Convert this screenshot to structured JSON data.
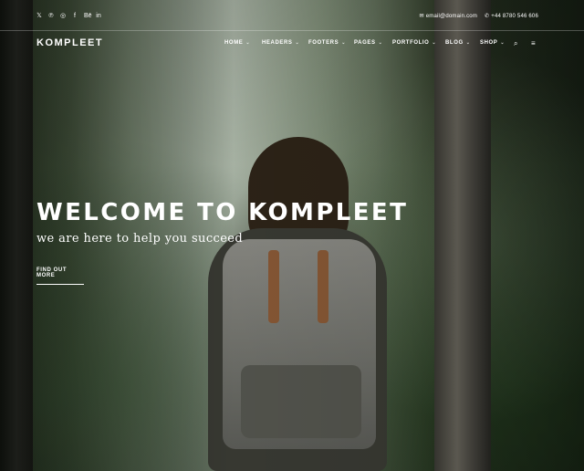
{
  "topbar": {
    "social_icons": [
      "twitter-icon",
      "pinterest-icon",
      "instagram-icon",
      "facebook-icon",
      "behance-icon",
      "linkedin-icon"
    ],
    "social_glyphs": [
      "𝕏",
      "℗",
      "◎",
      "f",
      "Bē",
      "in"
    ],
    "email": "email@domain.com",
    "phone": "+44 8780 546 606"
  },
  "header": {
    "logo": "KOMPLEET",
    "nav": [
      {
        "label": "HOME"
      },
      {
        "label": "HEADERS"
      },
      {
        "label": "FOOTERS"
      },
      {
        "label": "PAGES"
      },
      {
        "label": "PORTFOLIO"
      },
      {
        "label": "BLOG"
      },
      {
        "label": "SHOP"
      }
    ]
  },
  "hero": {
    "title": "WELCOME TO KOMPLEET",
    "subtitle": "we are here to help you succeed",
    "cta_label": "FIND OUT MORE"
  }
}
